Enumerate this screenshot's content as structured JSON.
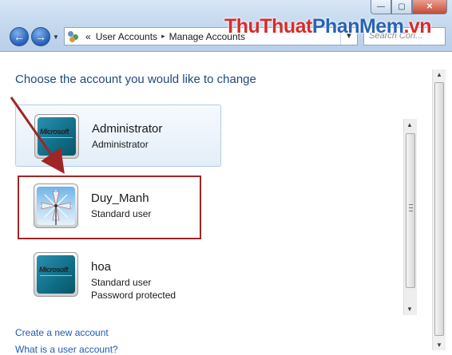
{
  "window": {
    "minimize_glyph": "—",
    "maximize_glyph": "▢",
    "close_glyph": "✕"
  },
  "nav": {
    "back_glyph": "←",
    "forward_glyph": "→",
    "recent_glyph": "▼"
  },
  "address": {
    "prefix": "«",
    "crumbs": [
      "User Accounts",
      "Manage Accounts"
    ],
    "separator": "▸",
    "dropdown_glyph": "▼"
  },
  "search": {
    "placeholder": "Search Con..."
  },
  "watermark": {
    "part1": "ThuThuat",
    "part2": "PhanMem",
    "part3": ".vn",
    "color_red": "#d62d2d",
    "color_blue": "#2a63b5"
  },
  "page": {
    "heading": "Choose the account you would like to change"
  },
  "accounts": [
    {
      "name": "Administrator",
      "type": "Administrator",
      "picture": "microsoft-logo",
      "picture_text": "Microsoft"
    },
    {
      "name": "Duy_Manh",
      "type": "Standard user",
      "picture": "windmill"
    },
    {
      "name": "hoa",
      "type": "Standard user",
      "extra": "Password protected",
      "picture": "microsoft-logo",
      "picture_text": "Microsoft"
    }
  ],
  "links": {
    "create_account": "Create a new account",
    "what_is": "What is a user account?"
  },
  "scrollbars": {
    "up_glyph": "▲",
    "down_glyph": "▼"
  },
  "colors": {
    "heading": "#1e4a7e",
    "link": "#1f5bb5",
    "highlight_box": "#a02525"
  }
}
